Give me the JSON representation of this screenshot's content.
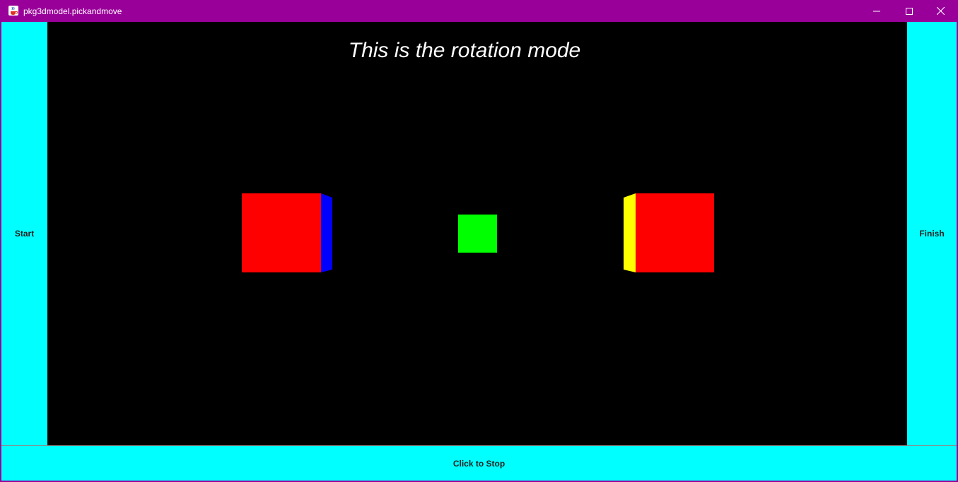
{
  "window": {
    "title": "pkg3dmodel.pickandmove",
    "app_icon": "java-cup-icon",
    "controls": {
      "minimize_icon": "minimize-icon",
      "maximize_icon": "maximize-icon",
      "close_icon": "close-icon"
    },
    "frame_color": "#990099"
  },
  "buttons": {
    "start_label": "Start",
    "finish_label": "Finish",
    "stop_label": "Click to Stop",
    "color": "#00ffff"
  },
  "canvas": {
    "mode_text": "This is the rotation mode",
    "background": "#000000",
    "objects": [
      {
        "name": "left-cube",
        "front_color": "#ff0000",
        "side_color": "#0000ff"
      },
      {
        "name": "center-cube",
        "front_color": "#00ff00"
      },
      {
        "name": "right-cube",
        "front_color": "#ff0000",
        "side_color": "#ffff00"
      }
    ]
  }
}
